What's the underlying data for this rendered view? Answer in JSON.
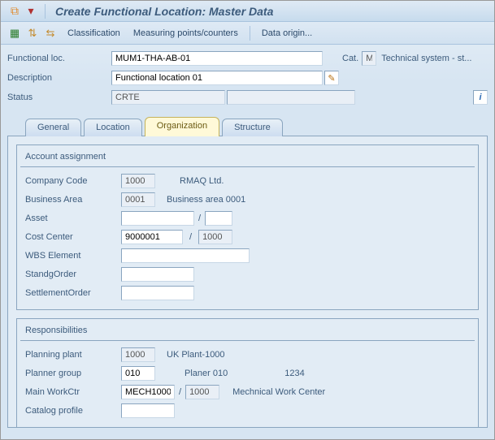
{
  "title": "Create Functional Location: Master Data",
  "toolbar": {
    "classification": "Classification",
    "measuring": "Measuring points/counters",
    "dataorigin": "Data origin..."
  },
  "header": {
    "funcloc_label": "Functional loc.",
    "funcloc_value": "MUM1-THA-AB-01",
    "cat_label": "Cat.",
    "cat_value": "M",
    "cat_text": "Technical system - st...",
    "description_label": "Description",
    "description_value": "Functional location 01",
    "status_label": "Status",
    "status_value": "CRTE"
  },
  "tabs": {
    "general": "General",
    "location": "Location",
    "organization": "Organization",
    "structure": "Structure"
  },
  "account": {
    "title": "Account assignment",
    "company_code_label": "Company Code",
    "company_code_value": "1000",
    "company_code_text": "RMAQ Ltd.",
    "business_area_label": "Business Area",
    "business_area_value": "0001",
    "business_area_text": "Business area 0001",
    "asset_label": "Asset",
    "asset_value": "",
    "asset_sub_value": "",
    "cost_center_label": "Cost Center",
    "cost_center_value": "9000001",
    "cost_center_co_value": "1000",
    "wbs_label": "WBS Element",
    "wbs_value": "",
    "standg_label": "StandgOrder",
    "standg_value": "",
    "settlement_label": "SettlementOrder",
    "settlement_value": ""
  },
  "resp": {
    "title": "Responsibilities",
    "plant_label": "Planning plant",
    "plant_value": "1000",
    "plant_text": "UK Plant-1000",
    "planner_label": "Planner group",
    "planner_value": "010",
    "planner_text": "Planer 010",
    "planner_phone": "1234",
    "workctr_label": "Main WorkCtr",
    "workctr_value": "MECH1000",
    "workctr_plant_value": "1000",
    "workctr_text": "Mechnical Work Center",
    "catalog_label": "Catalog profile",
    "catalog_value": ""
  }
}
